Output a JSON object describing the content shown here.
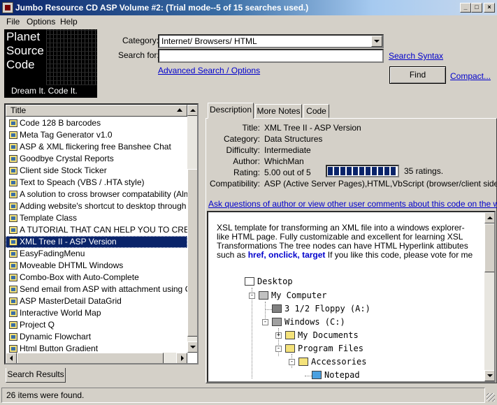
{
  "window": {
    "title": "Jumbo Resource CD ASP Volume #2: (Trial mode--5 of 15 searches used.)",
    "controls": [
      "_",
      "□",
      "×"
    ]
  },
  "menu": [
    "File",
    "Options",
    "Help"
  ],
  "logo": {
    "lines": [
      "Planet",
      "Source",
      "Code"
    ],
    "tagline": "Dream It.  Code It."
  },
  "search": {
    "category_label": "Category:",
    "category_value": "Internet/ Browsers/ HTML",
    "search_for_label": "Search for:",
    "search_for_value": "",
    "search_syntax_link": "Search Syntax",
    "advanced_link": "Advanced Search / Options",
    "find_button": "Find",
    "compact_link": "Compact..."
  },
  "results": {
    "header": "Title",
    "items": [
      "Code 128 B barcodes",
      "Meta Tag Generator v1.0",
      "ASP & XML flickering free Banshee Chat",
      "Goodbye Crystal Reports",
      "Client side Stock Ticker",
      "Text to Speach (VBS / .HTA style)",
      "A solution to cross browser compatability (Almost) *",
      "Adding website's shortcut to desktop through webs",
      "Template Class",
      "A TUTORIAL THAT CAN HELP YOU TO CREATE",
      "XML Tree II - ASP Version",
      "EasyFadingMenu",
      "Moveable DHTML Windows",
      "Combo-Box with Auto-Complete",
      "Send email from ASP with attachment using CDON",
      "ASP MasterDetail DataGrid",
      "Interactive World Map",
      "Project Q",
      "Dynamic Flowchart",
      "Html Button Gradient"
    ],
    "selected_index": 10,
    "bottom_tab": "Search Results"
  },
  "details": {
    "tabs": [
      "Description",
      "More Notes",
      "Code"
    ],
    "active_tab": "Description",
    "fields": [
      {
        "label": "Title:",
        "value": "XML Tree II - ASP Version"
      },
      {
        "label": "Category:",
        "value": "Data Structures"
      },
      {
        "label": "Difficulty:",
        "value": "Intermediate"
      },
      {
        "label": "Author:",
        "value": "WhichMan"
      },
      {
        "label": "Rating:",
        "value": "5.00 out of 5"
      },
      {
        "label": "Compatibility:",
        "value": "ASP (Active Server Pages),HTML,VbScript (browser/client side)"
      }
    ],
    "rating_fraction": 1.0,
    "ratings_count": "35 ratings.",
    "ask_link": "Ask questions of author or view other user comments about this code on the web...",
    "description": {
      "text1": "XSL template for transforming an XML file into a windows explorer-like HTML page. Fully customizable and excellent for learning XSL Transformations The tree nodes can have HTML Hyperlink attibutes such as ",
      "bold1": "href, onclick,",
      "bold2": "target",
      "text2": " If you like this code, please vote for me"
    },
    "tree": [
      "Desktop",
      "My Computer",
      "3 1/2 Floppy (A:)",
      "Windows (C:)",
      "My Documents",
      "Program Files",
      "Accessories",
      "Notepad"
    ]
  },
  "status": {
    "text": "26 items were found."
  }
}
